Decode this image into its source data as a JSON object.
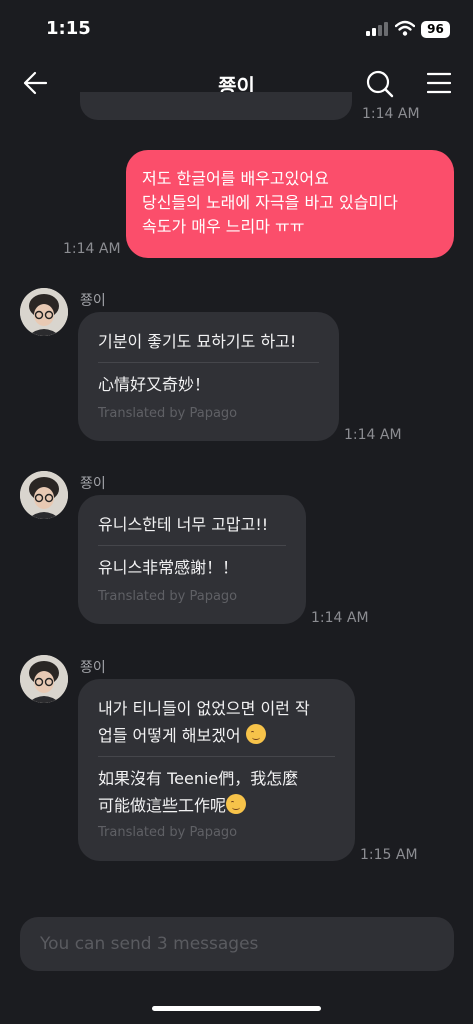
{
  "status_bar": {
    "time": "1:15",
    "battery": "96"
  },
  "header": {
    "title": "쭁이"
  },
  "previous": {
    "timestamp": "1:14 AM"
  },
  "sent_message": {
    "lines": [
      "저도 한글어를 배우고있어요",
      "당신들의 노래에 자극을 바고 있습미다",
      "속도가 매우 느리마 ㅠㅠ"
    ],
    "timestamp": "1:14 AM"
  },
  "received": [
    {
      "sender": "쭁이",
      "original": [
        "기분이 좋기도 묘하기도 하고!"
      ],
      "translation": [
        "心情好又奇妙！"
      ],
      "credit": "Translated by Papago",
      "timestamp": "1:14 AM"
    },
    {
      "sender": "쭁이",
      "original": [
        "유니스한테 너무 고맙고!!"
      ],
      "translation": [
        "유니스非常感謝！！"
      ],
      "credit": "Translated by Papago",
      "timestamp": "1:14 AM"
    },
    {
      "sender": "쭁이",
      "original": [
        "내가 티니들이 없었으면 이런 작",
        "업들 어떻게 해보겠어"
      ],
      "translation": [
        "如果沒有 Teenie們，我怎麼",
        "可能做這些工作呢"
      ],
      "credit": "Translated by Papago",
      "timestamp": "1:15 AM"
    }
  ],
  "input": {
    "placeholder": "You can send 3 messages"
  },
  "icons": {
    "back": "arrow-left-icon",
    "search": "search-icon",
    "menu": "hamburger-icon",
    "signal": "cellular-signal-icon",
    "wifi": "wifi-icon",
    "battery": "battery-icon",
    "emoji": "smiling-face-emoji"
  },
  "colors": {
    "background": "#1b1c20",
    "sent_bubble": "#fb4e6b",
    "received_bubble": "#303136"
  }
}
